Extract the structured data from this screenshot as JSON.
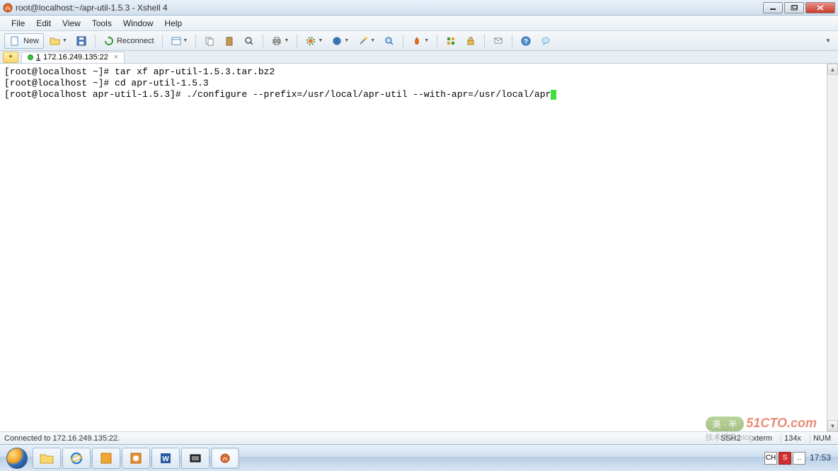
{
  "window": {
    "title": "root@localhost:~/apr-util-1.5.3 - Xshell 4"
  },
  "menu": {
    "file": "File",
    "edit": "Edit",
    "view": "View",
    "tools": "Tools",
    "window": "Window",
    "help": "Help"
  },
  "toolbar": {
    "new_label": "New",
    "reconnect_label": "Reconnect"
  },
  "tabs": {
    "add_glyph": "+",
    "session_num": "1",
    "session_label": "172.16.249.135:22",
    "close_glyph": "×"
  },
  "terminal": {
    "lines": [
      "[root@localhost ~]# tar xf apr-util-1.5.3.tar.bz2",
      "[root@localhost ~]# cd apr-util-1.5.3",
      "[root@localhost apr-util-1.5.3]# ./configure --prefix=/usr/local/apr-util --with-apr=/usr/local/apr"
    ]
  },
  "status": {
    "left": "Connected to 172.16.249.135:22.",
    "protocol": "SSH2",
    "termtype": "xterm",
    "size": "134x",
    "caps": "NUM"
  },
  "tray": {
    "ime1": "CH",
    "ime2": "S",
    "ime3": "‥",
    "clock": "17:53"
  },
  "watermark": {
    "badge": "英 · 半",
    "text": "51CTO.com",
    "sub": "技术博客  blog"
  },
  "icons": {
    "app": "xshell-icon",
    "new_doc": "📄",
    "folder_open": "📂",
    "save": "💾",
    "reconnect": "🔄",
    "terminal": "▣",
    "copy": "📋",
    "paste": "📄",
    "search": "🔍",
    "printer": "🖨",
    "tool_g": "⚙",
    "globe": "🌐",
    "wand": "✨",
    "zoom": "🔍",
    "fire": "🔥",
    "grid": "▦",
    "lock": "🔒",
    "msg": "💬",
    "help": "❓",
    "bubble": "🗨"
  }
}
